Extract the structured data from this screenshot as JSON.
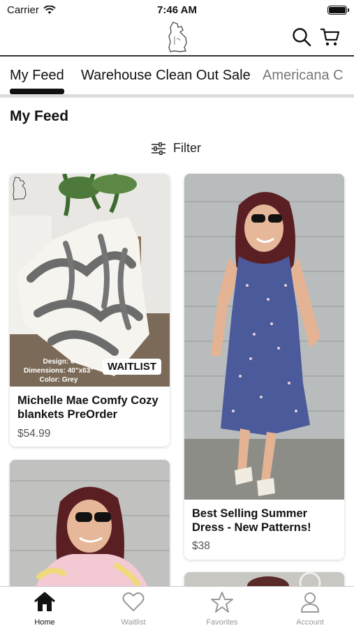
{
  "status": {
    "carrier": "Carrier",
    "time": "7:46 AM"
  },
  "header": {
    "logo_icon": "michigan-logo",
    "search_icon": "search-icon",
    "cart_icon": "cart-icon"
  },
  "tabs": [
    {
      "label": "My Feed",
      "active": true
    },
    {
      "label": "Warehouse Clean Out Sale",
      "active": false
    },
    {
      "label": "Americana C",
      "active": false
    }
  ],
  "section_title": "My Feed",
  "filter_label": "Filter",
  "products": [
    {
      "title": "Michelle Mae Comfy Cozy blankets PreOrder",
      "price": "$54.99",
      "badge": "WAITLIST",
      "overlay_lines": [
        "Design: 6",
        "Dimensions: 40\"x63\"",
        "Color: Grey"
      ]
    },
    {
      "title": "Best Selling Summer Dress - New Patterns!",
      "price": "$38"
    }
  ],
  "bottom_nav": [
    {
      "label": "Home",
      "icon": "home-icon",
      "active": true
    },
    {
      "label": "Waitlist",
      "icon": "heart-icon",
      "active": false
    },
    {
      "label": "Favorites",
      "icon": "star-icon",
      "active": false
    },
    {
      "label": "Account",
      "icon": "person-icon",
      "active": false
    }
  ],
  "colors": {
    "accent": "#111111",
    "inactive": "#999999",
    "dress": "#4a5a9a"
  }
}
